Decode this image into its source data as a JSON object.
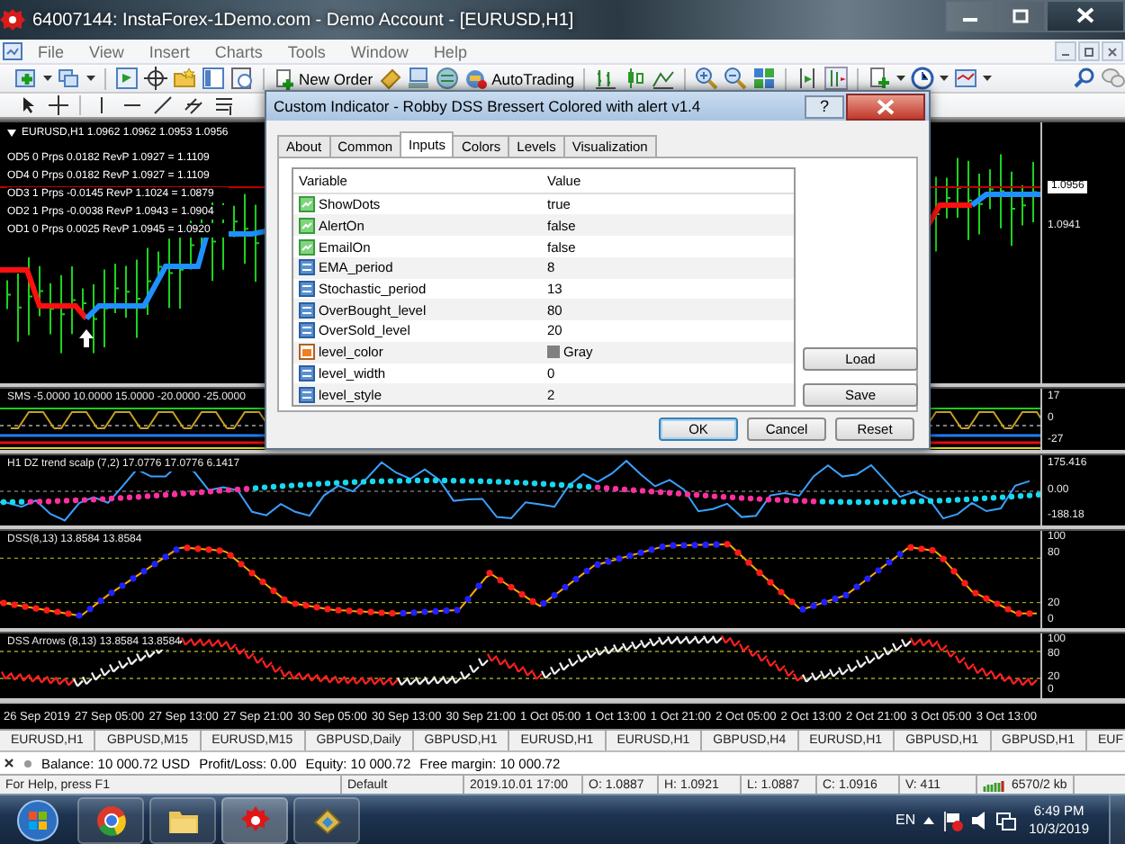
{
  "window": {
    "title": "64007144: InstaForex-1Demo.com - Demo Account - [EURUSD,H1]"
  },
  "menu": [
    "File",
    "View",
    "Insert",
    "Charts",
    "Tools",
    "Window",
    "Help"
  ],
  "toolbar": {
    "buttons": [
      "New Order",
      "AutoTrading"
    ]
  },
  "chart": {
    "symbol_line": "EURUSD,H1  1.0962 1.0962 1.0953 1.0956",
    "legend": [
      "OD5 0 Prps 0.0182 RevP 1.0927 = 1.1109",
      "OD4 0 Prps 0.0182 RevP 1.0927 = 1.1109",
      "OD3 1 Prps -0.0145 RevP 1.1024 = 1.0879",
      "OD2 1 Prps -0.0038 RevP 1.0943 = 1.0904",
      "OD1 0 Prps 0.0025 RevP 1.0945 = 1.0920"
    ],
    "price_axis": [
      {
        "text": "1.0956",
        "kind": "current"
      },
      {
        "text": "1.0941",
        "kind": "tick"
      }
    ],
    "panes": [
      {
        "kind": "sms",
        "label": "SMS -5.0000 10.0000 15.0000 -20.0000 -25.0000",
        "axis": [
          "17",
          "0",
          "-27"
        ]
      },
      {
        "kind": "dz",
        "label": "H1 DZ trend scalp (7,2) 17.0776 17.0776 6.1417",
        "axis": [
          "175.416",
          "0.00",
          "-188.18"
        ]
      },
      {
        "kind": "dss",
        "label": "DSS(8,13) 13.8584 13.8584",
        "axis": [
          "100",
          "80",
          "20",
          "0"
        ]
      },
      {
        "kind": "arrows",
        "label": "DSS Arrows (8,13) 13.8584 13.8584",
        "axis": [
          "100",
          "80",
          "20",
          "0"
        ]
      }
    ],
    "time_axis": [
      "26 Sep 2019",
      "27 Sep 05:00",
      "27 Sep 13:00",
      "27 Sep 21:00",
      "30 Sep 05:00",
      "30 Sep 13:00",
      "30 Sep 21:00",
      "1 Oct 05:00",
      "1 Oct 13:00",
      "1 Oct 21:00",
      "2 Oct 05:00",
      "2 Oct 13:00",
      "2 Oct 21:00",
      "3 Oct 05:00",
      "3 Oct 13:00"
    ]
  },
  "chart_tabs": [
    "EURUSD,H1",
    "GBPUSD,M15",
    "EURUSD,M15",
    "GBPUSD,Daily",
    "GBPUSD,H1",
    "EURUSD,H1",
    "EURUSD,H1",
    "GBPUSD,H4",
    "EURUSD,H1",
    "GBPUSD,H1",
    "GBPUSD,H1",
    "EUF"
  ],
  "terminal": [
    "Balance: 10 000.72 USD",
    "Profit/Loss: 0.00",
    "Equity: 10 000.72",
    "Free margin: 10 000.72"
  ],
  "status_bar": [
    "For Help, press F1",
    "Default",
    "2019.10.01 17:00",
    "O: 1.0887",
    "H: 1.0921",
    "L: 1.0887",
    "C: 1.0916",
    "V: 411",
    "6570/2 kb"
  ],
  "dialog": {
    "title": "Custom Indicator - Robby DSS Bressert Colored with alert v1.4",
    "help_button": "?",
    "tabs": [
      {
        "label": "About",
        "selected": false
      },
      {
        "label": "Common",
        "selected": false
      },
      {
        "label": "Inputs",
        "selected": true
      },
      {
        "label": "Colors",
        "selected": false
      },
      {
        "label": "Levels",
        "selected": false
      },
      {
        "label": "Visualization",
        "selected": false
      }
    ],
    "columns": [
      "Variable",
      "Value"
    ],
    "rows": [
      {
        "kind": "bool",
        "name": "ShowDots",
        "value": "true"
      },
      {
        "kind": "bool",
        "name": "AlertOn",
        "value": "false"
      },
      {
        "kind": "bool",
        "name": "EmailOn",
        "value": "false"
      },
      {
        "kind": "int",
        "name": "EMA_period",
        "value": "8"
      },
      {
        "kind": "int",
        "name": "Stochastic_period",
        "value": "13"
      },
      {
        "kind": "int",
        "name": "OverBought_level",
        "value": "80"
      },
      {
        "kind": "int",
        "name": "OverSold_level",
        "value": "20"
      },
      {
        "kind": "color",
        "name": "level_color",
        "value": "Gray",
        "color": "#808080"
      },
      {
        "kind": "int",
        "name": "level_width",
        "value": "0"
      },
      {
        "kind": "int",
        "name": "level_style",
        "value": "2"
      }
    ],
    "side_buttons": [
      "Load",
      "Save"
    ],
    "buttons": [
      "OK",
      "Cancel",
      "Reset"
    ]
  },
  "taskbar": {
    "language": "EN",
    "time": "6:49 PM",
    "date": "10/3/2019"
  }
}
